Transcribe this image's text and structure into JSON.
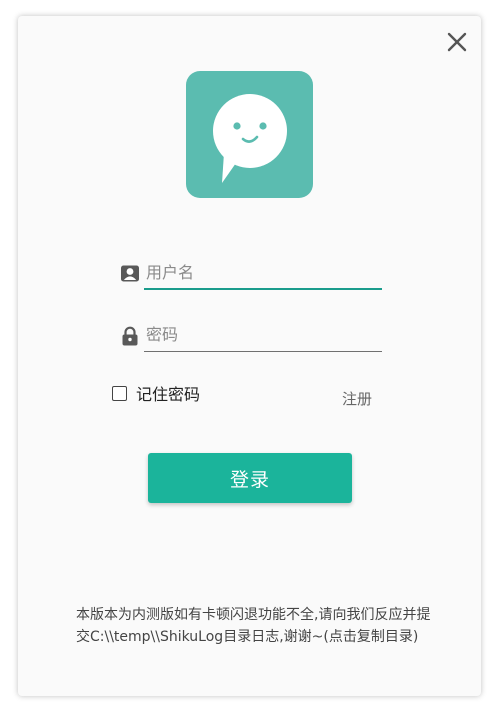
{
  "window": {
    "close_icon": "close-icon"
  },
  "logo": {
    "icon": "chat-bubble-smile-icon",
    "color": "#5bbcb0"
  },
  "form": {
    "username": {
      "icon": "user-card-icon",
      "placeholder": "用户名",
      "value": ""
    },
    "password": {
      "icon": "lock-icon",
      "placeholder": "密码",
      "value": ""
    },
    "remember_label": "记住密码",
    "remember_checked": false,
    "register_label": "注册",
    "login_label": "登录"
  },
  "notice": {
    "text": "本版本为内测版如有卡顿闪退功能不全,请向我们反应并提交C:\\\\temp\\\\ShikuLog目录日志,谢谢~(点击复制目录)"
  },
  "colors": {
    "accent": "#1bb49b",
    "active_underline": "#1a9c8c"
  }
}
